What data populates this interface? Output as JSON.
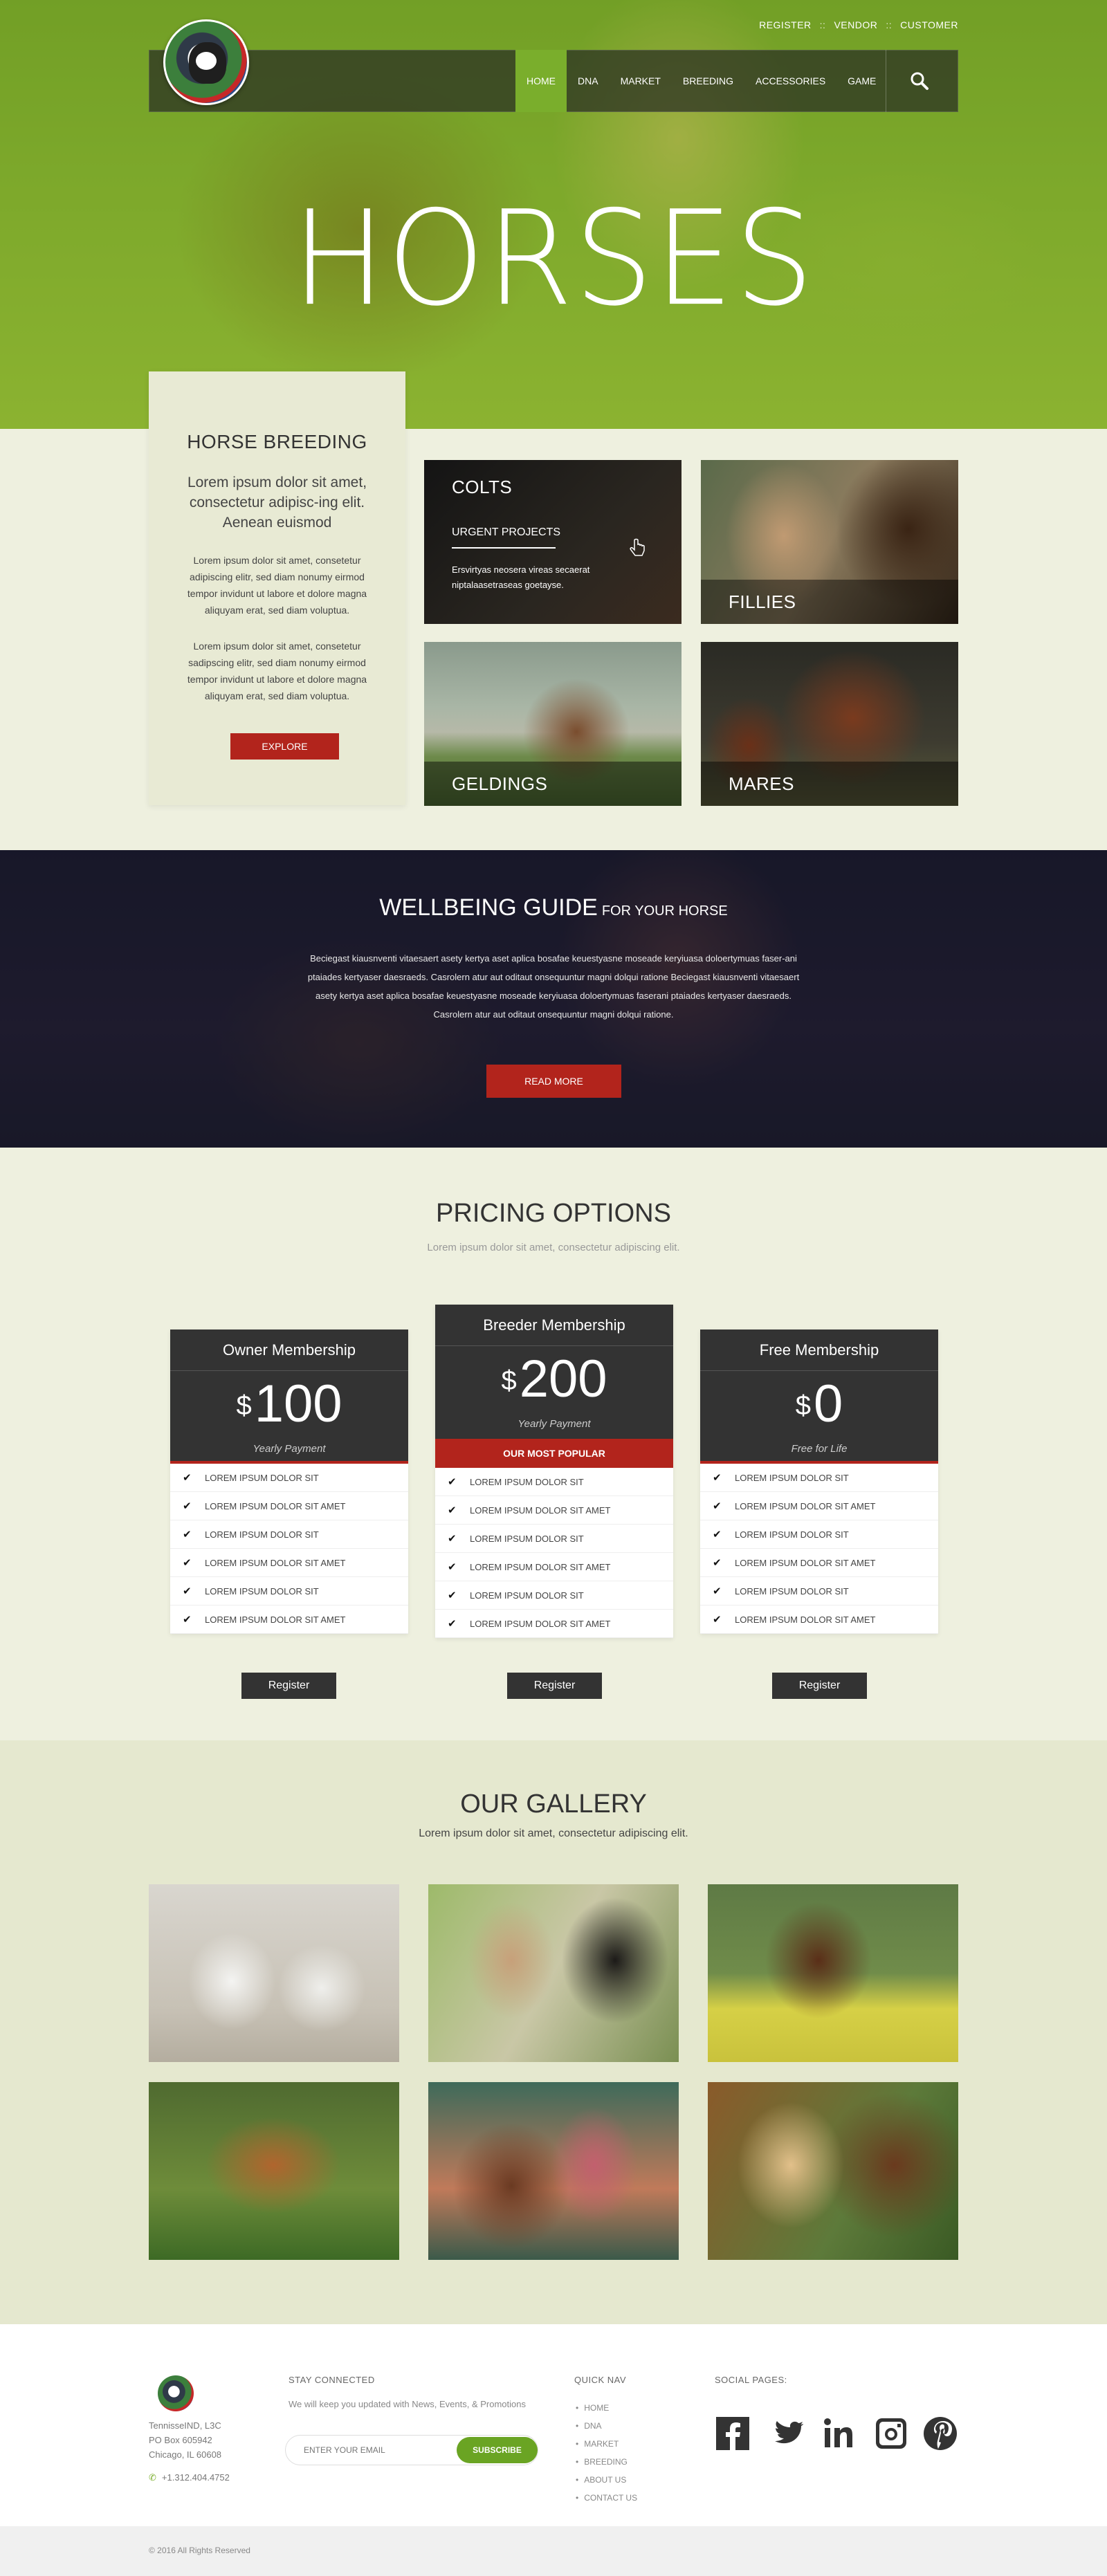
{
  "toplinks": [
    "REGISTER",
    "VENDOR",
    "CUSTOMER"
  ],
  "nav": {
    "items": [
      "HOME",
      "DNA",
      "MARKET",
      "BREEDING",
      "ACCESSORIES",
      "GAME"
    ],
    "active": "HOME"
  },
  "hero": {
    "title": "HORSES"
  },
  "breeding": {
    "title": "HORSE BREEDING",
    "lead": "Lorem ipsum dolor sit amet, consectetur adipisc-ing elit. Aenean euismod",
    "p1": "Lorem ipsum dolor sit amet, consetetur adipiscing elitr, sed diam nonumy eirmod tempor invidunt ut labore et dolore magna aliquyam erat, sed diam voluptua.",
    "p2": "Lorem ipsum dolor sit amet, consetetur sadipscing elitr, sed diam nonumy eirmod tempor invidunt ut labore et dolore magna aliquyam erat, sed diam voluptua.",
    "button": "EXPLORE"
  },
  "tiles": {
    "colts": {
      "title": "COLTS",
      "subtitle": "URGENT PROJECTS",
      "desc": "Ersvirtyas neosera vireas  secaerat niptalaasetraseas goetayse."
    },
    "fillies": "FILLIES",
    "geldings": "GELDINGS",
    "mares": "MARES"
  },
  "wellbeing": {
    "title": "WELLBEING GUIDE",
    "title_small": "FOR YOUR HORSE",
    "text": "Beciegast kiausnventi vitaesaert asety kertya aset aplica bosafae keuestyasne moseade keryiuasa doloertymuas faser-ani ptaiades kertyaser daesraeds. Casrolern atur aut oditaut onsequuntur magni dolqui ratione Beciegast kiausnventi vitaesaert asety kertya aset aplica bosafae keuestyasne moseade keryiuasa doloertymuas faserani ptaiades kertyaser daesraeds. Casrolern atur aut oditaut onsequuntur magni dolqui ratione.",
    "button": "READ MORE"
  },
  "pricing": {
    "title": "PRICING OPTIONS",
    "subtitle": "Lorem ipsum dolor sit amet, consectetur adipiscing elit.",
    "currency": "$",
    "plans": [
      {
        "name": "Owner Membership",
        "price": "100",
        "term": "Yearly Payment",
        "badge": "",
        "features": [
          "LOREM IPSUM DOLOR SIT",
          "LOREM IPSUM DOLOR SIT AMET",
          "LOREM IPSUM DOLOR SIT",
          "LOREM IPSUM DOLOR SIT AMET",
          "LOREM IPSUM DOLOR SIT",
          "LOREM IPSUM DOLOR SIT AMET"
        ],
        "button": "Register"
      },
      {
        "name": "Breeder Membership",
        "price": "200",
        "term": "Yearly Payment",
        "badge": "OUR MOST POPULAR",
        "features": [
          "LOREM IPSUM DOLOR SIT",
          "LOREM IPSUM DOLOR SIT AMET",
          "LOREM IPSUM DOLOR SIT",
          "LOREM IPSUM DOLOR SIT AMET",
          "LOREM IPSUM DOLOR SIT",
          "LOREM IPSUM DOLOR SIT AMET"
        ],
        "button": "Register"
      },
      {
        "name": "Free Membership",
        "price": "0",
        "term": "Free for Life",
        "badge": "",
        "features": [
          "LOREM IPSUM DOLOR SIT",
          "LOREM IPSUM DOLOR SIT AMET",
          "LOREM IPSUM DOLOR SIT",
          "LOREM IPSUM DOLOR SIT AMET",
          "LOREM IPSUM DOLOR SIT",
          "LOREM IPSUM DOLOR SIT AMET"
        ],
        "button": "Register"
      }
    ]
  },
  "gallery": {
    "title": "OUR GALLERY",
    "subtitle": "Lorem ipsum dolor sit amet, consectetur adipiscing elit."
  },
  "footer": {
    "address": [
      "TennisseIND, L3C",
      "PO Box 605942",
      "Chicago, IL 60608"
    ],
    "phone": "+1.312.404.4752",
    "stay_title": "STAY CONNECTED",
    "stay_text": "We will keep you updated with News, Events, & Promotions",
    "email_placeholder": "ENTER YOUR EMAIL",
    "subscribe": "SUBSCRIBE",
    "quicknav_title": "QUICK NAV",
    "quicknav": [
      "HOME",
      "DNA",
      "MARKET",
      "BREEDING",
      "ABOUT US",
      "CONTACT US"
    ],
    "social_title": "SOCIAL PAGES:",
    "social": [
      "facebook-icon",
      "twitter-icon",
      "linkedin-icon",
      "instagram-icon",
      "pinterest-icon"
    ],
    "copyright": "© 2016 All Rights Reserved"
  },
  "colors": {
    "accent_green": "#7aae2c",
    "accent_red": "#b2241c",
    "dark": "#333333"
  }
}
